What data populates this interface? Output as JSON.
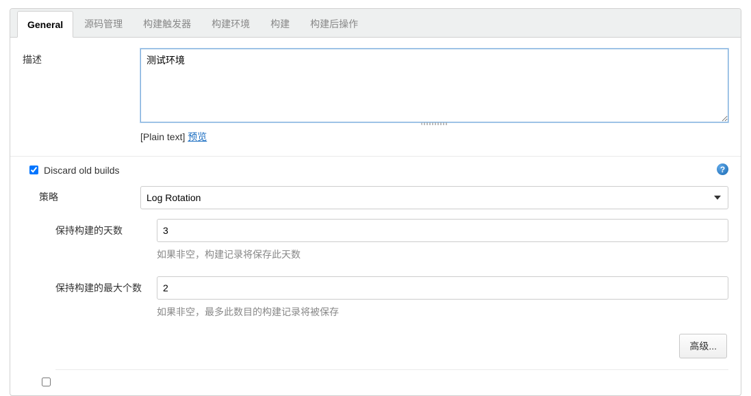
{
  "tabs": {
    "general": "General",
    "scm": "源码管理",
    "triggers": "构建触发器",
    "env": "构建环境",
    "build": "构建",
    "postbuild": "构建后操作"
  },
  "description": {
    "label": "描述",
    "value": "测试环境",
    "plain_text": "[Plain text]",
    "preview_link": "预览"
  },
  "discard": {
    "checked": true,
    "label": "Discard old builds",
    "help_icon": "?"
  },
  "strategy": {
    "label": "策略",
    "selected": "Log Rotation"
  },
  "days": {
    "label": "保持构建的天数",
    "value": "3",
    "help": "如果非空，构建记录将保存此天数"
  },
  "max": {
    "label": "保持构建的最大个数",
    "value": "2",
    "help": "如果非空，最多此数目的构建记录将被保存"
  },
  "advanced_button": "高级..."
}
